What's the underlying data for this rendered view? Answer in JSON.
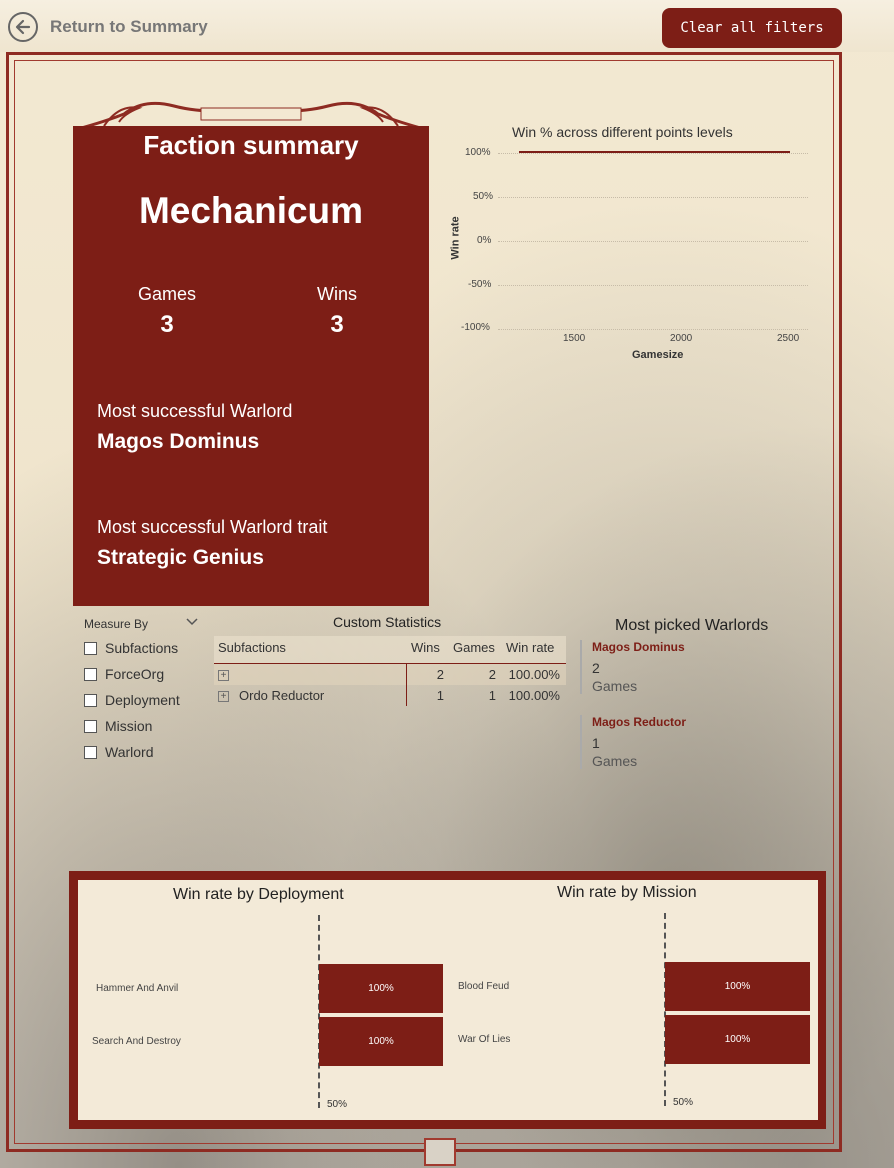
{
  "header": {
    "back_label": "Return to Summary",
    "clear_label": "Clear all filters"
  },
  "card": {
    "title": "Faction summary",
    "faction": "Mechanicum",
    "games_label": "Games",
    "games_value": "3",
    "wins_label": "Wins",
    "wins_value": "3",
    "warlord_label": "Most successful Warlord",
    "warlord_value": "Magos Dominus",
    "trait_label": "Most successful Warlord trait",
    "trait_value": "Strategic Genius"
  },
  "winpct_chart": {
    "title": "Win % across different points levels",
    "ylabel": "Win rate",
    "xlabel": "Gamesize",
    "y_ticks": [
      "100%",
      "50%",
      "0%",
      "-50%",
      "-100%"
    ],
    "x_ticks": [
      "1500",
      "2000",
      "2500"
    ],
    "legend_color": "#7d1e16"
  },
  "slicer": {
    "header": "Measure By",
    "items": [
      "Subfactions",
      "ForceOrg",
      "Deployment",
      "Mission",
      "Warlord"
    ]
  },
  "custom_stats": {
    "title": "Custom Statistics",
    "columns": [
      "Subfactions",
      "Wins",
      "Games",
      "Win rate"
    ],
    "rows": [
      {
        "name": "",
        "wins": "2",
        "games": "2",
        "winrate": "100.00%"
      },
      {
        "name": "Ordo Reductor",
        "wins": "1",
        "games": "1",
        "winrate": "100.00%"
      }
    ]
  },
  "most_picked": {
    "title": "Most picked Warlords",
    "items": [
      {
        "name": "Magos Dominus",
        "value": "2",
        "unit": "Games"
      },
      {
        "name": "Magos Reductor",
        "value": "1",
        "unit": "Games"
      }
    ]
  },
  "chart_data": [
    {
      "type": "bar",
      "title": "Win rate by Deployment",
      "categories": [
        "Hammer And Anvil",
        "Search And Destroy"
      ],
      "values": [
        1.0,
        1.0
      ],
      "value_labels": [
        "100%",
        "100%"
      ],
      "reference_line": {
        "value": 0.5,
        "label": "50%"
      }
    },
    {
      "type": "bar",
      "title": "Win rate by Mission",
      "categories": [
        "Blood Feud",
        "War Of Lies"
      ],
      "values": [
        1.0,
        1.0
      ],
      "value_labels": [
        "100%",
        "100%"
      ],
      "reference_line": {
        "value": 0.5,
        "label": "50%"
      }
    }
  ],
  "colors": {
    "accent": "#7d1e16",
    "parchment": "#f3ead8"
  }
}
